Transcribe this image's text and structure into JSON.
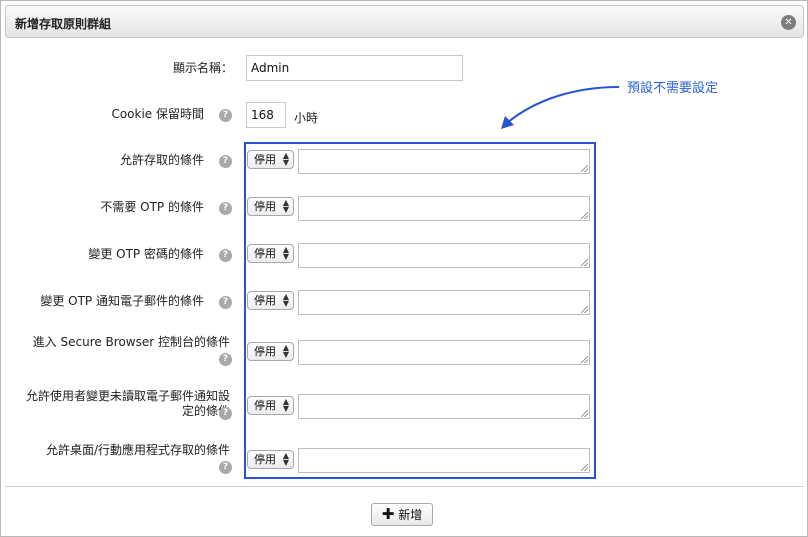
{
  "dialog": {
    "title": "新增存取原則群組",
    "close_icon": "close-icon"
  },
  "form": {
    "display_name_label": "顯示名稱：",
    "display_name_value": "Admin",
    "cookie_label": "Cookie 保留時間",
    "cookie_value": "168",
    "cookie_unit": "小時",
    "help_glyph": "?",
    "conditions": [
      {
        "label": "允許存取的條件",
        "select_value": "停用",
        "text": ""
      },
      {
        "label": "不需要 OTP 的條件",
        "select_value": "停用",
        "text": ""
      },
      {
        "label": "變更 OTP 密碼的條件",
        "select_value": "停用",
        "text": ""
      },
      {
        "label": "變更 OTP 通知電子郵件的條件",
        "select_value": "停用",
        "text": ""
      },
      {
        "label": "進入 Secure Browser 控制台的條件",
        "select_value": "停用",
        "text": ""
      },
      {
        "label": "允許使用者變更未讀取電子郵件通知設定的條件",
        "select_value": "停用",
        "text": ""
      },
      {
        "label": "允許桌面/行動應用程式存取的條件",
        "select_value": "停用",
        "text": ""
      }
    ]
  },
  "annotation": {
    "text": "預設不需要設定",
    "color": "#2a62d6"
  },
  "footer": {
    "add_label": "新增"
  }
}
